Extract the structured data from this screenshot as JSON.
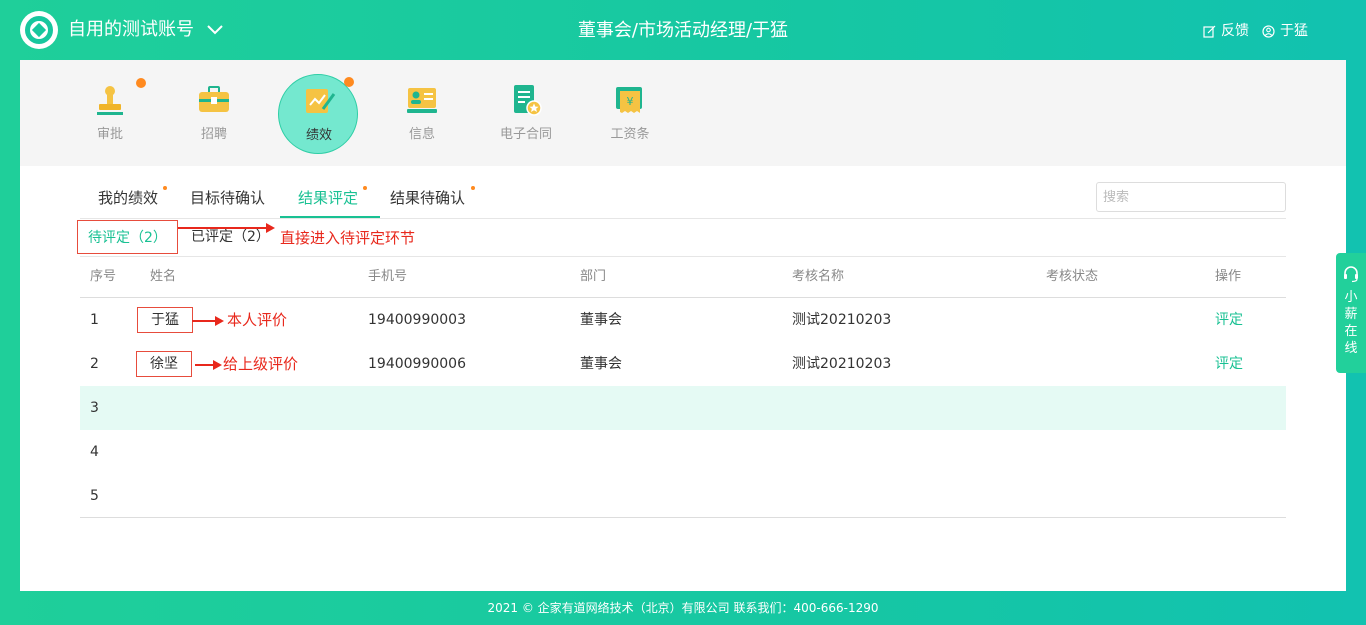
{
  "header": {
    "account_name": "自用的测试账号",
    "title": "董事会/市场活动经理/于猛",
    "feedback_label": "反馈",
    "user_name": "于猛"
  },
  "apps": [
    {
      "label": "审批",
      "icon": "stamp-icon",
      "badge": true
    },
    {
      "label": "招聘",
      "icon": "briefcase-icon",
      "badge": false
    },
    {
      "label": "绩效",
      "icon": "performance-chart-icon",
      "badge": true,
      "active": true
    },
    {
      "label": "信息",
      "icon": "profile-card-icon",
      "badge": false
    },
    {
      "label": "电子合同",
      "icon": "contract-document-icon",
      "badge": false
    },
    {
      "label": "工资条",
      "icon": "payslip-icon",
      "badge": false
    }
  ],
  "tabs": [
    {
      "label": "我的绩效",
      "dot": true
    },
    {
      "label": "目标待确认",
      "dot": false
    },
    {
      "label": "结果评定",
      "dot": true,
      "active": true
    },
    {
      "label": "结果待确认",
      "dot": true
    }
  ],
  "search": {
    "placeholder": "搜索",
    "value": ""
  },
  "subtabs": [
    {
      "label": "待评定（2）",
      "active": true
    },
    {
      "label": "已评定（2）",
      "active": false
    }
  ],
  "annotations": {
    "subtab_note": "直接进入待评定环节",
    "row1_note": "本人评价",
    "row2_note": "给上级评价"
  },
  "table": {
    "headers": [
      "序号",
      "姓名",
      "手机号",
      "部门",
      "考核名称",
      "考核状态",
      "操作"
    ],
    "rows": [
      {
        "index": "1",
        "name": "于猛",
        "phone": "19400990003",
        "department": "董事会",
        "assessment": "测试20210203",
        "status": "",
        "action": "评定"
      },
      {
        "index": "2",
        "name": "徐坚",
        "phone": "19400990006",
        "department": "董事会",
        "assessment": "测试20210203",
        "status": "",
        "action": "评定"
      },
      {
        "index": "3",
        "name": "",
        "phone": "",
        "department": "",
        "assessment": "",
        "status": "",
        "action": ""
      },
      {
        "index": "4",
        "name": "",
        "phone": "",
        "department": "",
        "assessment": "",
        "status": "",
        "action": ""
      },
      {
        "index": "5",
        "name": "",
        "phone": "",
        "department": "",
        "assessment": "",
        "status": "",
        "action": ""
      }
    ]
  },
  "online_service": {
    "label": "小薪在线"
  },
  "footer": {
    "text": "2021 © 企家有道网络技术（北京）有限公司   联系我们：400-666-1290"
  },
  "colors": {
    "brand": "#19c193",
    "accent_dot": "#ff8a1f",
    "annotation": "#e8281c",
    "row_highlight": "#e5faf4"
  }
}
